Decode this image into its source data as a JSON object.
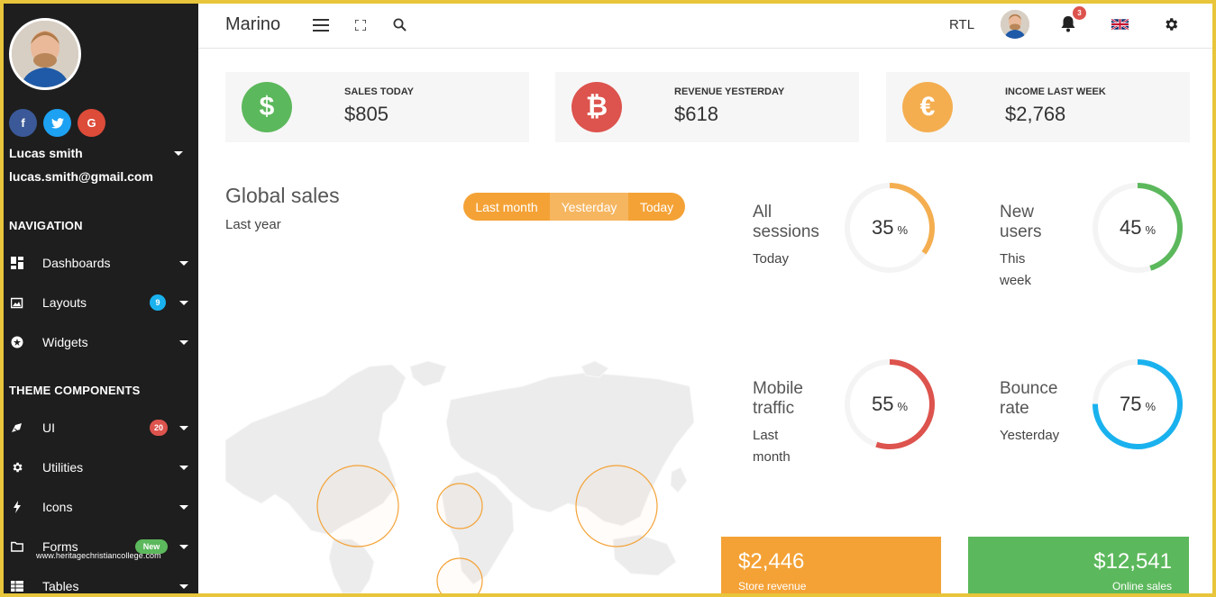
{
  "brand": "Marino",
  "colors": {
    "frame": "#e8c53a",
    "sidebar_bg": "#1e1e1e",
    "green": "#5cb85c",
    "red": "#dd534d",
    "orange": "#f4a236",
    "blue": "#1ab2ee",
    "facebook": "#3b5998",
    "twitter": "#1da1f2",
    "google": "#dd4b39"
  },
  "sidebar": {
    "user_name": "Lucas smith",
    "user_email": "lucas.smith@gmail.com",
    "socials": [
      {
        "label": "f",
        "icon": "facebook-icon"
      },
      {
        "label": "t",
        "icon": "twitter-icon"
      },
      {
        "label": "G",
        "icon": "google-icon"
      }
    ],
    "navigation_title": "NAVIGATION",
    "theme_title": "THEME COMPONENTS",
    "items": [
      {
        "label": "Dashboards",
        "icon": "dashboard-icon"
      },
      {
        "label": "Layouts",
        "icon": "image-icon",
        "badge": "9"
      },
      {
        "label": "Widgets",
        "icon": "star-icon"
      },
      {
        "label": "UI",
        "icon": "brush-icon",
        "badge": "20"
      },
      {
        "label": "Utilities",
        "icon": "gear-icon"
      },
      {
        "label": "Icons",
        "icon": "bolt-icon"
      },
      {
        "label": "Forms",
        "icon": "folder-icon",
        "badge": "New"
      },
      {
        "label": "Tables",
        "icon": "table-icon"
      }
    ],
    "watermark": "www.heritagechristiancollege.com"
  },
  "topbar": {
    "rtl_label": "RTL",
    "notification_count": "3",
    "icons": [
      "menu-icon",
      "fullscreen-icon",
      "search-icon",
      "bell-icon",
      "flag-uk-icon",
      "gear-icon"
    ]
  },
  "stats": [
    {
      "label": "SALES TODAY",
      "value": "$805",
      "symbol": "$",
      "icon": "dollar-icon"
    },
    {
      "label": "REVENUE YESTERDAY",
      "value": "$618",
      "symbol": "₿",
      "icon": "bitcoin-icon"
    },
    {
      "label": "INCOME LAST WEEK",
      "value": "$2,768",
      "symbol": "€",
      "icon": "euro-icon"
    }
  ],
  "global_sales": {
    "title": "Global sales",
    "subtitle": "Last year",
    "tabs": [
      "Last month",
      "Yesterday",
      "Today"
    ],
    "active_tab": "Yesterday"
  },
  "donuts": [
    {
      "title_line1": "All",
      "title_line2": "sessions",
      "sub_line1": "Today",
      "sub_line2": "",
      "value": "35",
      "pct": "%",
      "percent": 35
    },
    {
      "title_line1": "New",
      "title_line2": "users",
      "sub_line1": "This",
      "sub_line2": "week",
      "value": "45",
      "pct": "%",
      "percent": 45
    },
    {
      "title_line1": "Mobile",
      "title_line2": "traffic",
      "sub_line1": "Last",
      "sub_line2": "month",
      "value": "55",
      "pct": "%",
      "percent": 55
    },
    {
      "title_line1": "Bounce",
      "title_line2": "rate",
      "sub_line1": "Yesterday",
      "sub_line2": "",
      "value": "75",
      "pct": "%",
      "percent": 75
    }
  ],
  "bottom_cards": [
    {
      "value": "$2,446",
      "label": "Store revenue"
    },
    {
      "value": "$12,541",
      "label": "Online sales"
    }
  ]
}
